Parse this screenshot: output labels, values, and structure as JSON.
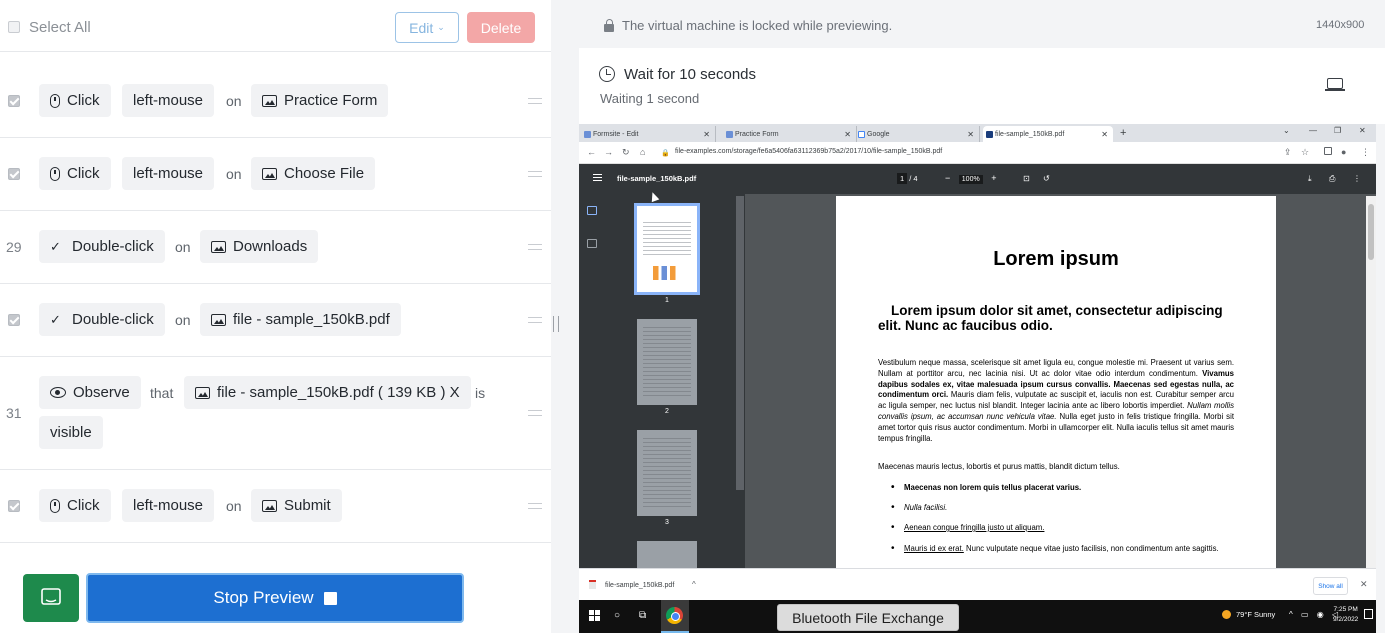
{
  "toolbar": {
    "select_all": "Select All",
    "edit": "Edit",
    "delete": "Delete"
  },
  "steps": [
    {
      "num": "",
      "checked": true,
      "action": "Click",
      "param": "left-mouse",
      "connector": "on",
      "target": "Practice Form"
    },
    {
      "num": "",
      "checked": true,
      "action": "Click",
      "param": "left-mouse",
      "connector": "on",
      "target": "Choose File"
    },
    {
      "num": "29",
      "checked": false,
      "action": "Double-click",
      "connector": "on",
      "target": "Downloads"
    },
    {
      "num": "",
      "checked": true,
      "action": "Double-click",
      "connector": "on",
      "target": "file - sample_150kB.pdf"
    },
    {
      "num": "31",
      "checked": false,
      "action": "Observe",
      "connector": "that",
      "target": "file - sample_150kB.pdf ( 139 KB ) X",
      "connector2": "is",
      "state": "visible"
    },
    {
      "num": "",
      "checked": true,
      "action": "Click",
      "param": "left-mouse",
      "connector": "on",
      "target": "Submit"
    }
  ],
  "stop_preview": "Stop Preview",
  "preview": {
    "lock_message": "The virtual machine is locked while previewing.",
    "resolution": "1440x900",
    "wait_title": "Wait for 10 seconds",
    "wait_sub": "Waiting 1 second"
  },
  "browser": {
    "tabs": [
      "Formsite - Edit",
      "Practice Form",
      "Google",
      "file-sample_150kB.pdf"
    ],
    "url": "file-examples.com/storage/fe6a5406fa63112369b75a2/2017/10/file-sample_150kB.pdf",
    "pdf_title": "file-sample_150kB.pdf",
    "page_current": "1",
    "page_total": "/ 4",
    "zoom": "100%",
    "thumb_pages": [
      "1",
      "2",
      "3"
    ],
    "doc": {
      "h1": "Lorem ipsum",
      "h2": "Lorem ipsum dolor sit amet, consectetur adipiscing elit. Nunc ac faucibus odio.",
      "p1_a": "Vestibulum neque massa, scelerisque sit amet ligula eu, congue molestie mi. Praesent ut varius sem. Nullam at porttitor arcu, nec lacinia nisi. Ut ac dolor vitae odio interdum condimentum. ",
      "p1_b": "Vivamus dapibus sodales ex, vitae malesuada ipsum cursus convallis. Maecenas sed egestas nulla, ac condimentum orci.",
      "p1_c": " Mauris diam felis, vulputate ac suscipit et, iaculis non est. Curabitur semper arcu ac ligula semper, nec luctus nisl blandit. Integer lacinia ante ac libero lobortis imperdiet. ",
      "p1_d": "Nullam mollis convallis ipsum, ac accumsan nunc vehicula vitae.",
      "p1_e": " Nulla eget justo in felis tristique fringilla. Morbi sit amet tortor quis risus auctor condimentum. Morbi in ullamcorper elit. Nulla iaculis tellus sit amet mauris tempus fringilla.",
      "p2": "Maecenas mauris lectus, lobortis et purus mattis, blandit dictum tellus.",
      "li1": "Maecenas non lorem quis tellus placerat varius.",
      "li2": "Nulla facilisi.",
      "li3": "Aenean congue fringilla justo ut aliquam.",
      "li4_a": "Mauris id ex erat.",
      "li4_b": " Nunc vulputate neque vitae justo facilisis, non condimentum ante sagittis."
    },
    "download_name": "file-sample_150kB.pdf",
    "show_all": "Show all"
  },
  "taskbar": {
    "weather": "79°F  Sunny",
    "time": "7:25 PM",
    "date": "9/2/2022"
  },
  "tooltip": "Bluetooth File Exchange"
}
